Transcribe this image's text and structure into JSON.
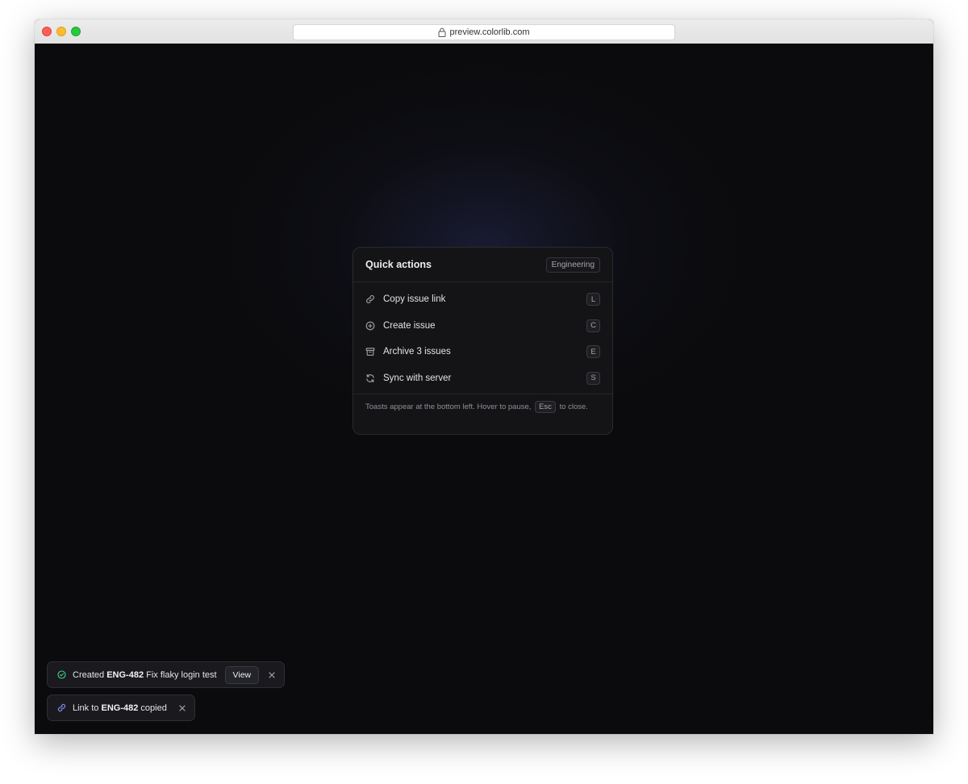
{
  "browser": {
    "url": "preview.colorlib.com"
  },
  "panel": {
    "title": "Quick actions",
    "team": "Engineering",
    "actions": [
      {
        "label": "Copy issue link",
        "shortcut": "L",
        "icon": "link-icon"
      },
      {
        "label": "Create issue",
        "shortcut": "C",
        "icon": "plus-circle-icon"
      },
      {
        "label": "Archive 3 issues",
        "shortcut": "E",
        "icon": "archive-icon"
      },
      {
        "label": "Sync with server",
        "shortcut": "S",
        "icon": "refresh-icon"
      }
    ],
    "footer": {
      "text_before": "Toasts appear at the bottom left. Hover to pause,",
      "key": "Esc",
      "text_after": "to close."
    }
  },
  "toasts": [
    {
      "icon": "check-circle-icon",
      "prefix": "Created",
      "issue_id": "ENG-482",
      "suffix": "Fix flaky login test",
      "action_label": "View"
    },
    {
      "icon": "link-icon",
      "prefix": "Link to",
      "issue_id": "ENG-482",
      "suffix": "copied"
    }
  ],
  "colors": {
    "success": "#3ecf8e",
    "link_accent": "#8b8cf5",
    "background": "#0b0b0d"
  }
}
